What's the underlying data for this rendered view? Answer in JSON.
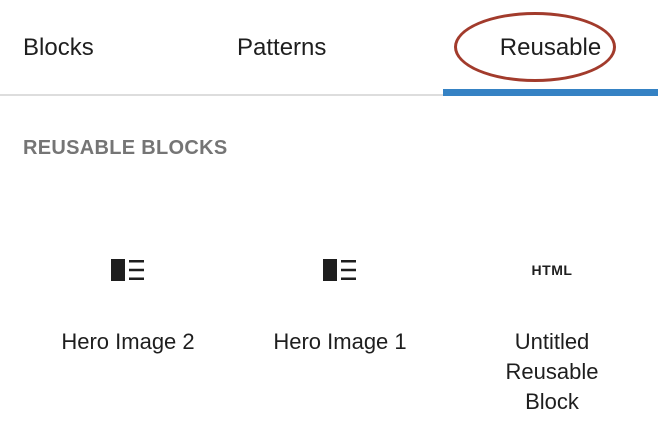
{
  "tabs": [
    {
      "label": "Blocks"
    },
    {
      "label": "Patterns"
    },
    {
      "label": "Reusable"
    }
  ],
  "active_tab": "Reusable",
  "accent_color": "#3582c4",
  "highlight_color": "#a23b2c",
  "section": {
    "title": "REUSABLE BLOCKS"
  },
  "blocks": [
    {
      "label": "Hero Image 2",
      "icon": "media-text-icon"
    },
    {
      "label": "Hero Image 1",
      "icon": "media-text-icon"
    },
    {
      "label": "Untitled Reusable Block",
      "icon": "html-icon",
      "icon_text": "HTML"
    }
  ]
}
